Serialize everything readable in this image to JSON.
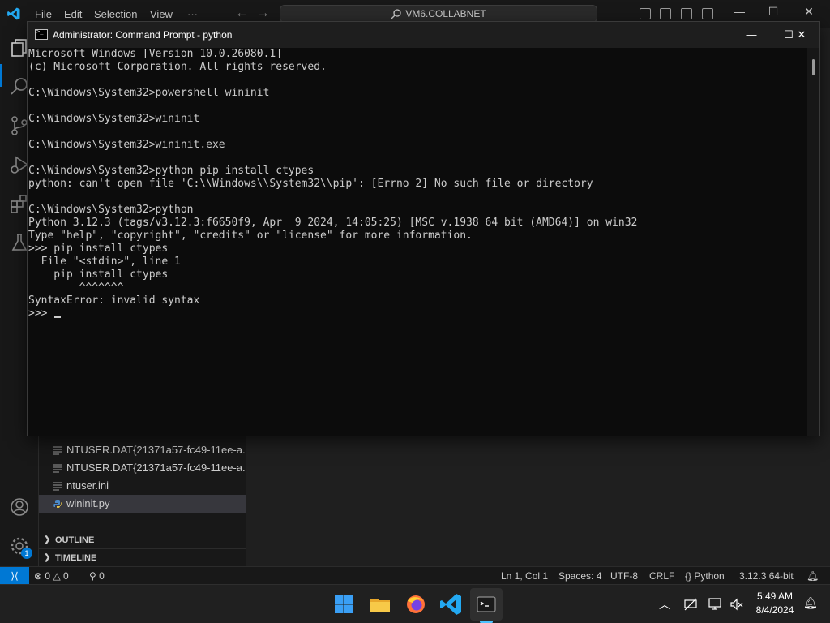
{
  "vscode": {
    "menu": [
      "File",
      "Edit",
      "Selection",
      "View",
      "···"
    ],
    "command_center": "VM6.COLLABNET",
    "window_controls": [
      "—",
      "☐",
      "✕"
    ]
  },
  "sidebar": {
    "files": [
      {
        "name": "NTUSER.DAT{21371a57-fc49-11ee-a...",
        "icon": "file-lines-icon",
        "selected": false
      },
      {
        "name": "NTUSER.DAT{21371a57-fc49-11ee-a...",
        "icon": "file-lines-icon",
        "selected": false
      },
      {
        "name": "ntuser.ini",
        "icon": "file-lines-icon",
        "selected": false
      },
      {
        "name": "wininit.py",
        "icon": "python-file-icon",
        "selected": true
      }
    ],
    "sections": [
      "OUTLINE",
      "TIMELINE"
    ]
  },
  "statusbar": {
    "errors": "0",
    "warnings": "0",
    "ports": "0",
    "position": "Ln 1, Col 1",
    "spaces": "Spaces: 4",
    "encoding": "UTF-8",
    "eol": "CRLF",
    "language": "Python",
    "interpreter": "3.12.3 64-bit"
  },
  "activitybar": {
    "badge": "1"
  },
  "cmd": {
    "title": "Administrator: Command Prompt - python",
    "lines": [
      "Microsoft Windows [Version 10.0.26080.1]",
      "(c) Microsoft Corporation. All rights reserved.",
      "",
      "C:\\Windows\\System32>powershell wininit",
      "",
      "C:\\Windows\\System32>wininit",
      "",
      "C:\\Windows\\System32>wininit.exe",
      "",
      "C:\\Windows\\System32>python pip install ctypes",
      "python: can't open file 'C:\\\\Windows\\\\System32\\\\pip': [Errno 2] No such file or directory",
      "",
      "C:\\Windows\\System32>python",
      "Python 3.12.3 (tags/v3.12.3:f6650f9, Apr  9 2024, 14:05:25) [MSC v.1938 64 bit (AMD64)] on win32",
      "Type \"help\", \"copyright\", \"credits\" or \"license\" for more information.",
      ">>> pip install ctypes",
      "  File \"<stdin>\", line 1",
      "    pip install ctypes",
      "        ^^^^^^^",
      "SyntaxError: invalid syntax"
    ],
    "prompt": ">>> "
  },
  "taskbar": {
    "apps": [
      "start-icon",
      "file-explorer-icon",
      "firefox-icon",
      "vscode-icon",
      "terminal-icon"
    ],
    "time": "5:49 AM",
    "date": "8/4/2024"
  },
  "colors": {
    "vscode_blue": "#0078d4",
    "console_bg": "#0c0c0c",
    "console_fg": "#cccccc"
  }
}
